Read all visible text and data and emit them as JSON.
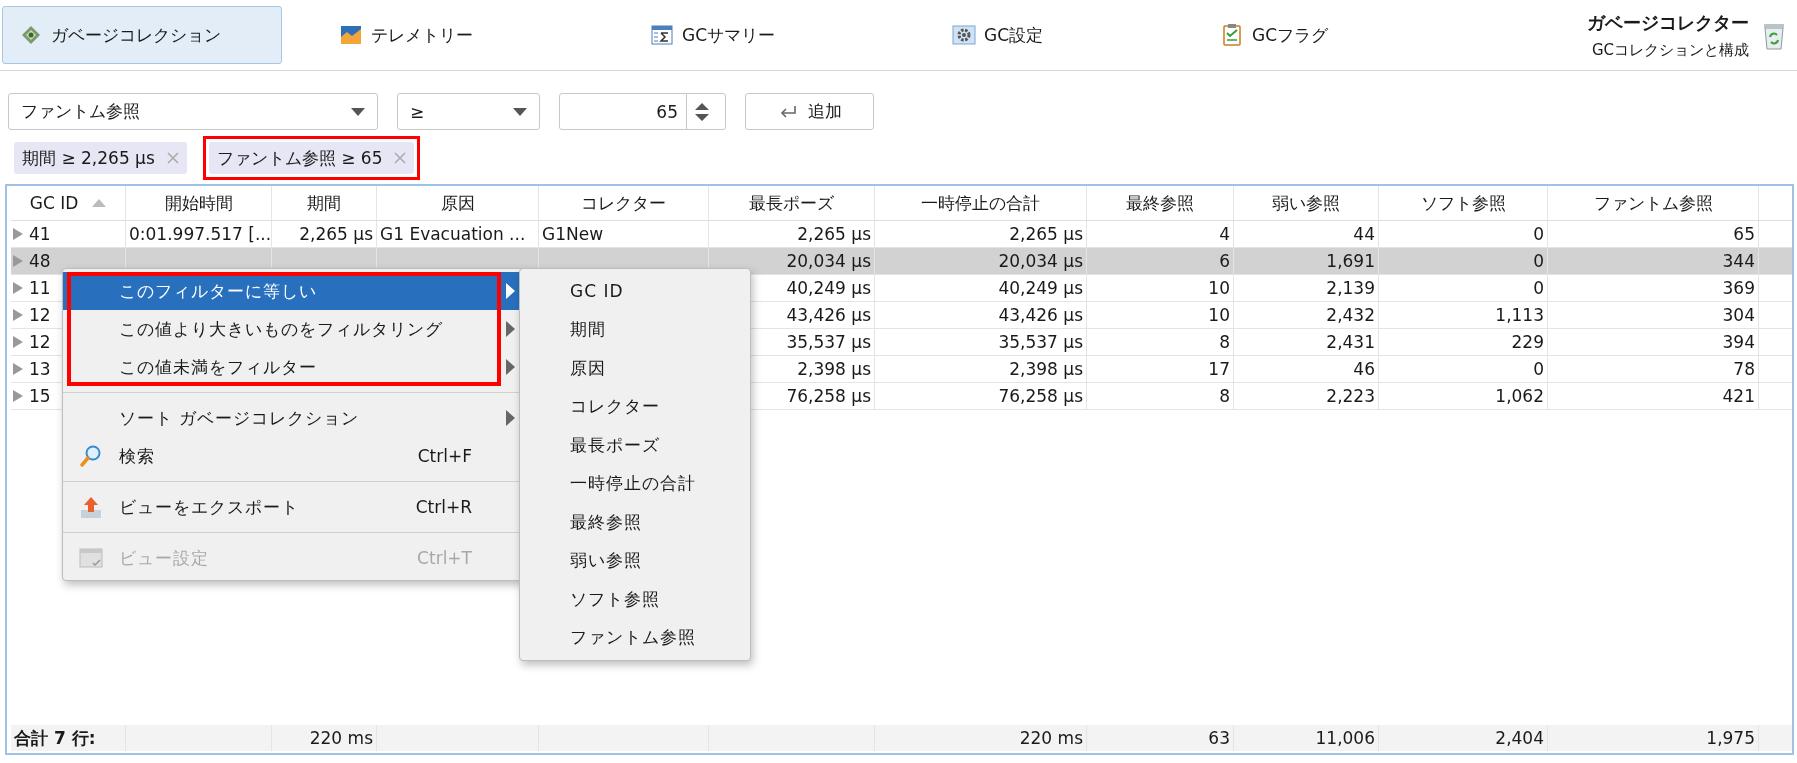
{
  "toolbar": {
    "tabs": [
      {
        "label": "ガベージコレクション",
        "selected": true
      },
      {
        "label": "テレメトリー",
        "selected": false
      },
      {
        "label": "GCサマリー",
        "selected": false
      },
      {
        "label": "GC設定",
        "selected": false
      },
      {
        "label": "GCフラグ",
        "selected": false
      }
    ],
    "title": "ガベージコレクター",
    "subtitle": "GCコレクションと構成"
  },
  "filter": {
    "field": "ファントム参照",
    "operator": "≥",
    "value": "65",
    "add_button": "追加",
    "chips": [
      {
        "label": "期間 ≥ 2,265 μs",
        "highlighted": false
      },
      {
        "label": "ファントム参照 ≥ 65",
        "highlighted": true
      }
    ]
  },
  "table": {
    "columns": [
      {
        "label": "GC ID",
        "sorted": true
      },
      {
        "label": "開始時間",
        "sorted": false
      },
      {
        "label": "期間",
        "sorted": false
      },
      {
        "label": "原因",
        "sorted": false
      },
      {
        "label": "コレクター",
        "sorted": false
      },
      {
        "label": "最長ポーズ",
        "sorted": false
      },
      {
        "label": "一時停止の合計",
        "sorted": false
      },
      {
        "label": "最終参照",
        "sorted": false
      },
      {
        "label": "弱い参照",
        "sorted": false
      },
      {
        "label": "ソフト参照",
        "sorted": false
      },
      {
        "label": "ファントム参照",
        "sorted": false
      }
    ],
    "rows": [
      {
        "id": "41",
        "selected": false,
        "start_time": "0:01.997.517 [...",
        "duration": "2,265 μs",
        "cause": "G1 Evacuation ...",
        "collector": "G1New",
        "values": [
          "2,265 μs",
          "2,265 μs",
          "4",
          "44",
          "0",
          "65"
        ]
      },
      {
        "id": "48",
        "selected": true,
        "values": [
          "20,034 μs",
          "20,034 μs",
          "6",
          "1,691",
          "0",
          "344"
        ]
      },
      {
        "id": "11",
        "selected": false,
        "values": [
          "40,249 μs",
          "40,249 μs",
          "10",
          "2,139",
          "0",
          "369"
        ]
      },
      {
        "id": "12",
        "selected": false,
        "values": [
          "43,426 μs",
          "43,426 μs",
          "10",
          "2,432",
          "1,113",
          "304"
        ]
      },
      {
        "id": "12",
        "selected": false,
        "values": [
          "35,537 μs",
          "35,537 μs",
          "8",
          "2,431",
          "229",
          "394"
        ]
      },
      {
        "id": "13",
        "selected": false,
        "values": [
          "2,398 μs",
          "2,398 μs",
          "17",
          "46",
          "0",
          "78"
        ]
      },
      {
        "id": "15",
        "selected": false,
        "values": [
          "76,258 μs",
          "76,258 μs",
          "8",
          "2,223",
          "1,062",
          "421"
        ]
      }
    ],
    "footer": {
      "label": "合計 7 行:",
      "duration": "220 ms",
      "total_pause": "220 ms",
      "final_refs": "63",
      "weak_refs": "11,006",
      "soft_refs": "2,404",
      "phantom_refs": "1,975"
    }
  },
  "context_menu": {
    "sections": [
      {
        "framed": true,
        "items": [
          {
            "label": "このフィルターに等しい",
            "submenu": true,
            "selected": true,
            "disabled": false
          },
          {
            "label": "この値より大きいものをフィルタリング",
            "submenu": true,
            "selected": false,
            "disabled": false
          },
          {
            "label": "この値未満をフィルター",
            "submenu": true,
            "selected": false,
            "disabled": false
          }
        ]
      },
      {
        "framed": false,
        "items": [
          {
            "label": "ソート ガベージコレクション",
            "submenu": true,
            "selected": false,
            "disabled": false
          },
          {
            "label": "検索",
            "shortcut": "Ctrl+F",
            "submenu": false,
            "selected": false,
            "disabled": false
          }
        ]
      },
      {
        "framed": false,
        "items": [
          {
            "label": "ビューをエクスポート",
            "shortcut": "Ctrl+R",
            "submenu": false,
            "selected": false,
            "disabled": false
          }
        ]
      },
      {
        "framed": false,
        "items": [
          {
            "label": "ビュー設定",
            "shortcut": "Ctrl+T",
            "submenu": false,
            "selected": false,
            "disabled": true
          }
        ]
      }
    ],
    "submenu": {
      "items": [
        "GC ID",
        "期間",
        "原因",
        "コレクター",
        "最長ポーズ",
        "一時停止の合計",
        "最終参照",
        "弱い参照",
        "ソフト参照",
        "ファントム参照"
      ]
    }
  }
}
